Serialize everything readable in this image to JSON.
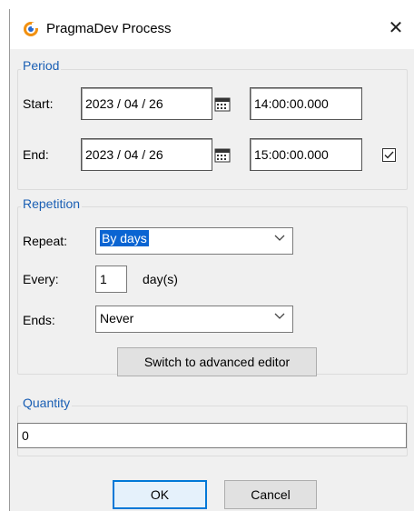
{
  "window": {
    "title": "PragmaDev Process",
    "close_glyph": "✕"
  },
  "period": {
    "legend": "Period",
    "start_label": "Start:",
    "start_date": "2023 / 04 / 26",
    "start_time": "14:00:00.000",
    "end_label": "End:",
    "end_date": "2023 / 04 / 26",
    "end_time": "15:00:00.000",
    "end_checked": true
  },
  "repetition": {
    "legend": "Repetition",
    "repeat_label": "Repeat:",
    "repeat_value": "By days",
    "every_label": "Every:",
    "every_value": "1",
    "every_unit": "day(s)",
    "ends_label": "Ends:",
    "ends_value": "Never",
    "advanced_button": "Switch to advanced editor"
  },
  "quantity": {
    "legend": "Quantity",
    "value": "0"
  },
  "footer": {
    "ok": "OK",
    "cancel": "Cancel"
  },
  "colors": {
    "accent": "#1a5fb4",
    "selection": "#0a64d2",
    "default_button_border": "#0078d7"
  },
  "icons": {
    "app": "pragmadev-logo-icon",
    "calendar": "calendar-icon",
    "close": "close-icon",
    "dropdown": "chevron-down-icon"
  }
}
